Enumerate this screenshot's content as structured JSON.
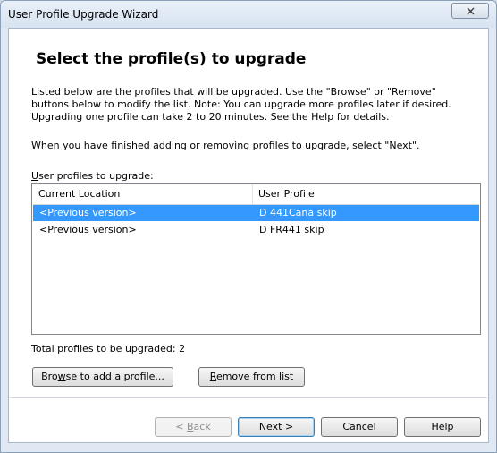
{
  "window": {
    "title": "User Profile Upgrade Wizard"
  },
  "page": {
    "heading": "Select the profile(s) to upgrade",
    "description": "Listed below are the profiles that will be upgraded. Use the \"Browse\" or \"Remove\"\nbuttons below to modify the list. Note: You can upgrade more profiles later if desired.\nUpgrading one profile can take 2 to 20 minutes. See the Help for details.",
    "instruction": "When you have finished adding or removing profiles to upgrade, select \"Next\".",
    "list_label_mnemonic": "U",
    "list_label_rest": "ser profiles to upgrade:"
  },
  "list": {
    "columns": [
      "Current Location",
      "User Profile"
    ],
    "rows": [
      {
        "location": "<Previous version>",
        "profile": "D 441Cana skip",
        "selected": true
      },
      {
        "location": "<Previous version>",
        "profile": "D FR441 skip",
        "selected": false
      }
    ]
  },
  "total": {
    "label": "Total profiles to be upgraded:",
    "count": "2"
  },
  "actions": {
    "browse": {
      "pre": "Bro",
      "mnemonic": "w",
      "post": "se to add a profile..."
    },
    "remove": {
      "pre": "",
      "mnemonic": "R",
      "post": "emove from list"
    }
  },
  "footer": {
    "back": {
      "pre": "< ",
      "mnemonic": "B",
      "post": "ack"
    },
    "next": "Next >",
    "cancel": "Cancel",
    "help": "Help"
  },
  "icons": {
    "close": "close-icon"
  }
}
